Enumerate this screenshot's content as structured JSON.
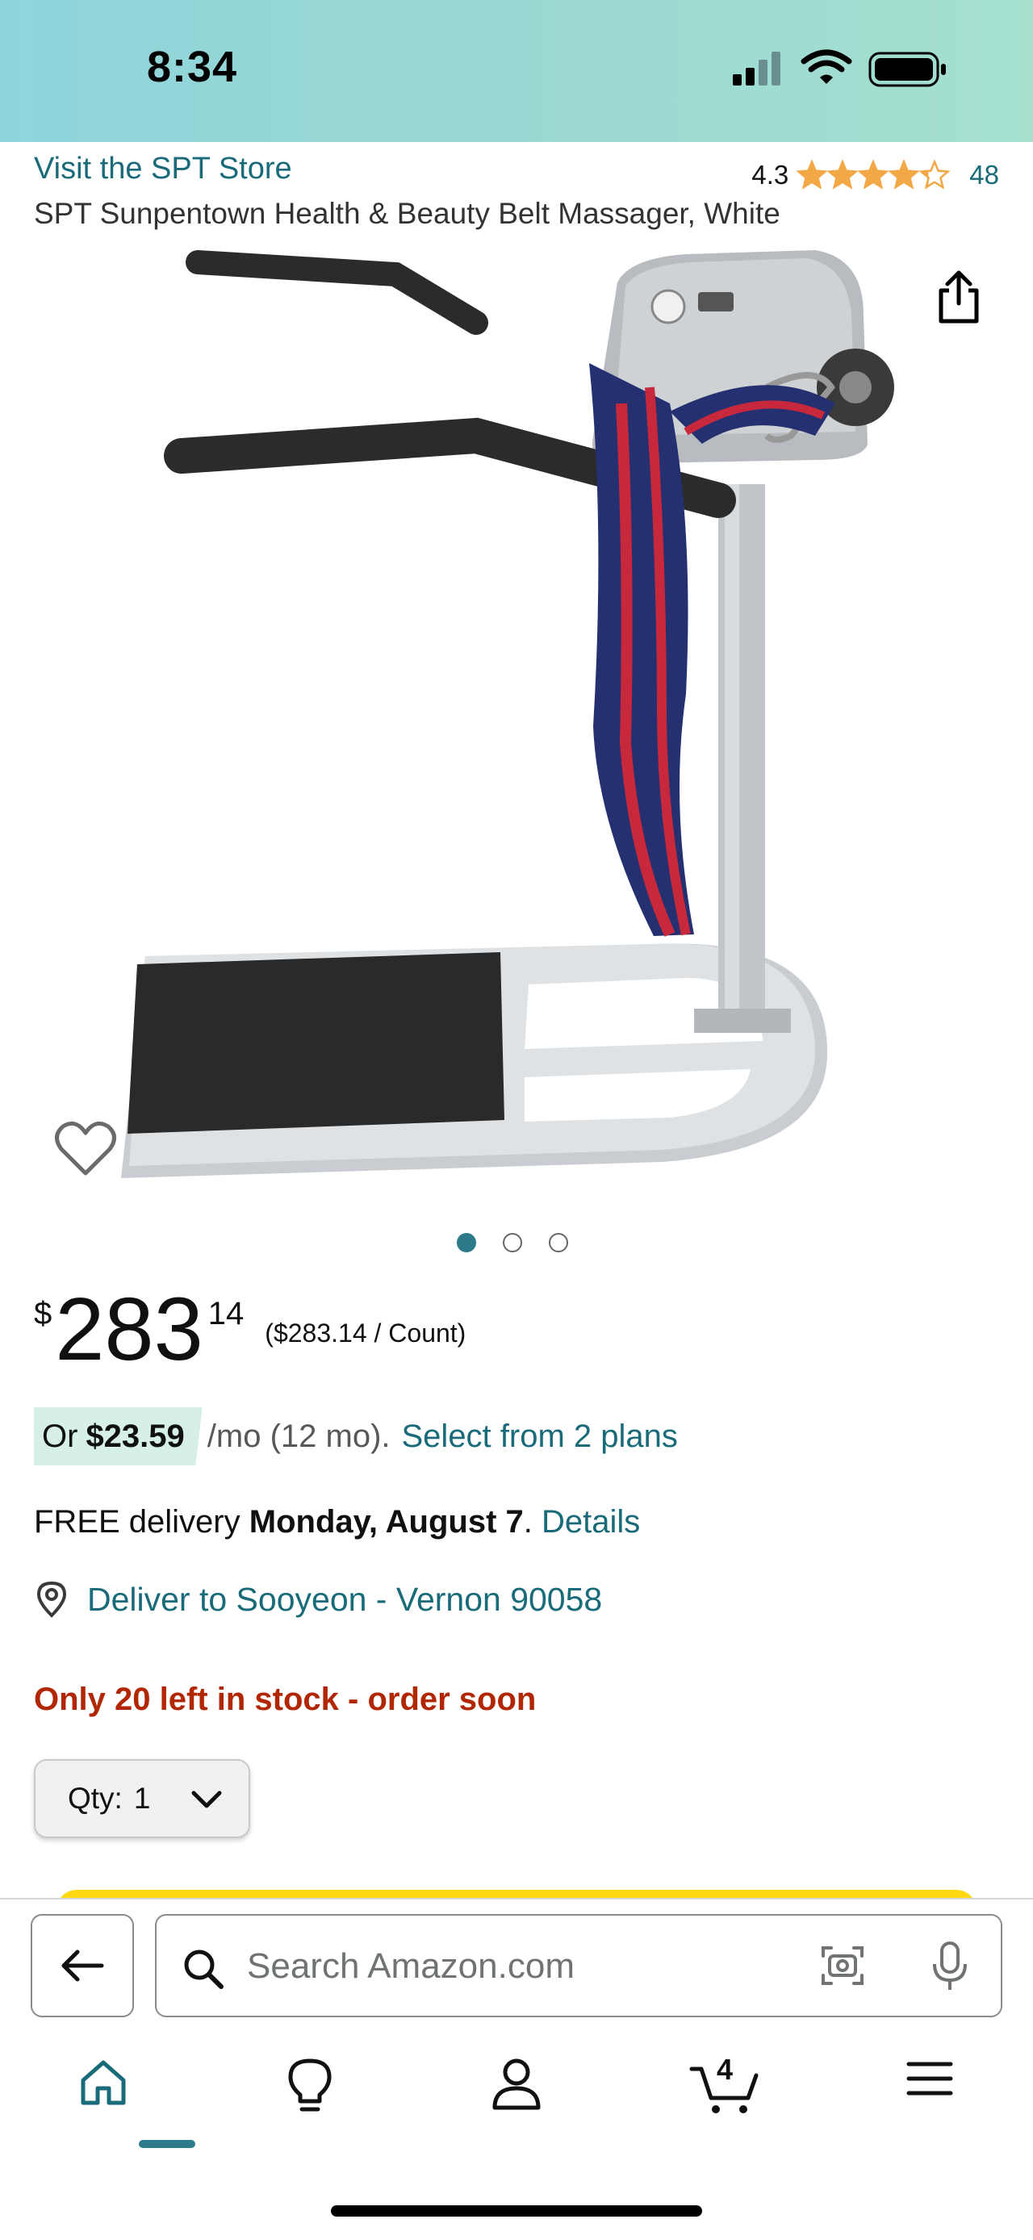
{
  "status_bar": {
    "time": "8:34"
  },
  "header": {
    "store_link": "Visit the SPT Store",
    "rating_value": "4.3",
    "rating_stars": 4.3,
    "rating_count": "48",
    "title": "SPT Sunpentown Health & Beauty Belt Massager, White"
  },
  "gallery": {
    "image_count": 3,
    "active_index": 0
  },
  "price": {
    "symbol": "$",
    "whole": "283",
    "fraction": "14",
    "per_unit": "($283.14 / Count)"
  },
  "financing": {
    "prefix": "Or",
    "monthly": "$23.59",
    "term": "/mo (12 mo).",
    "link": "Select from 2 plans"
  },
  "delivery": {
    "prefix": "FREE delivery",
    "date": "Monday, August 7",
    "period": ".",
    "details_link": "Details"
  },
  "location": {
    "text": "Deliver to Sooyeon - Vernon 90058"
  },
  "stock": {
    "text": "Only 20 left in stock - order soon"
  },
  "quantity": {
    "label": "Qty:",
    "value": "1"
  },
  "search": {
    "placeholder": "Search Amazon.com"
  },
  "bottom_nav": {
    "items": [
      "home-icon",
      "lightbulb-icon",
      "account-icon",
      "cart-icon",
      "menu-icon"
    ],
    "cart_count": "4",
    "active": "home"
  },
  "colors": {
    "link": "#1a6b7a",
    "stock_warning": "#b12704",
    "star": "#f3a847",
    "financing_badge": "#d6f0e6",
    "buy_button": "#ffd814"
  }
}
